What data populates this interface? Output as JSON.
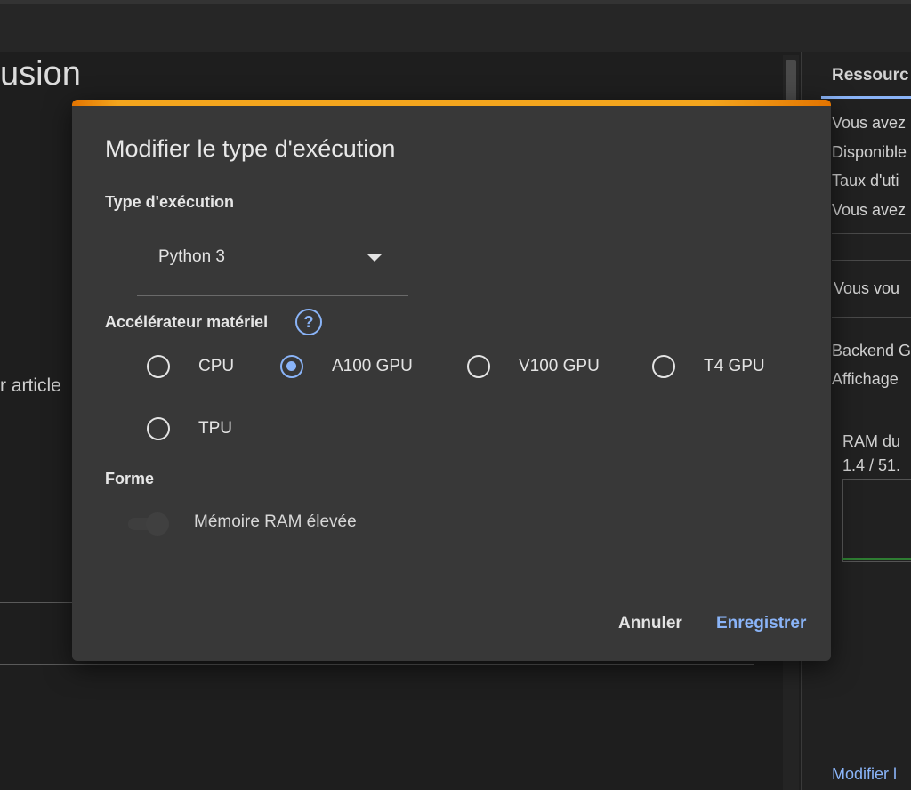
{
  "background": {
    "title_fragment": "usion",
    "article_fragment": "r article"
  },
  "right_panel": {
    "heading": "Ressourc",
    "lines": [
      "Vous avez",
      "Disponible",
      "Taux d'uti",
      "Vous avez"
    ],
    "line2": "Vous vou",
    "backend": [
      "Backend G",
      "Affichage"
    ],
    "ram_label": "RAM du",
    "ram_value": "1.4 / 51.",
    "footer_link": "Modifier l"
  },
  "dialog": {
    "title": "Modifier le type d'exécution",
    "runtime_label": "Type d'exécution",
    "runtime_value": "Python 3",
    "accelerator_label": "Accélérateur matériel",
    "help_glyph": "?",
    "accelerators": [
      {
        "label": "CPU",
        "checked": false
      },
      {
        "label": "A100 GPU",
        "checked": true
      },
      {
        "label": "V100 GPU",
        "checked": false
      },
      {
        "label": "T4 GPU",
        "checked": false
      },
      {
        "label": "TPU",
        "checked": false
      }
    ],
    "shape_label": "Forme",
    "high_ram_label": "Mémoire RAM élevée",
    "high_ram_enabled": false,
    "cancel_label": "Annuler",
    "save_label": "Enregistrer"
  },
  "colors": {
    "accent": "#8ab4f8",
    "top_bar_orange": "#e37400",
    "top_bar_yellow": "#f3a51d",
    "dialog_bg": "#383838"
  },
  "icons": [
    "help-icon",
    "dropdown-arrow-icon"
  ]
}
